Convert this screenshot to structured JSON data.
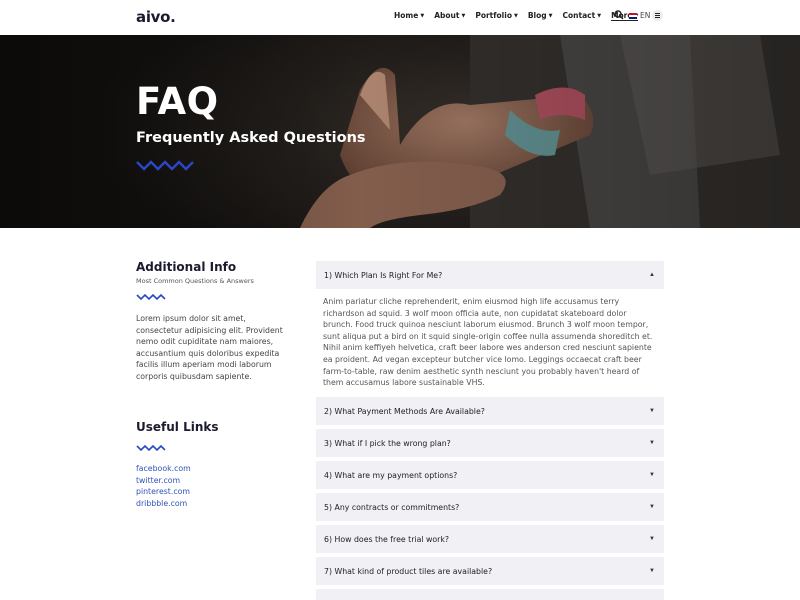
{
  "header": {
    "logo": "aivo.",
    "nav": [
      {
        "label": "Home",
        "active": false
      },
      {
        "label": "About",
        "active": false
      },
      {
        "label": "Portfolio",
        "active": false
      },
      {
        "label": "Blog",
        "active": false
      },
      {
        "label": "Contact",
        "active": false
      },
      {
        "label": "More",
        "active": true
      }
    ],
    "lang": "EN",
    "search_icon": "search-icon",
    "menu_icon": "hamburger-icon"
  },
  "hero": {
    "title": "FAQ",
    "subtitle": "Frequently Asked Questions"
  },
  "sidebar": {
    "info_title": "Additional Info",
    "info_sub": "Most Common Questions & Answers",
    "info_text": "Lorem ipsum dolor sit amet, consectetur adipisicing elit. Provident nemo odit cupiditate nam maiores, accusantium quis doloribus expedita facilis illum aperiam modi laborum corporis quibusdam sapiente.",
    "links_title": "Useful Links",
    "links": [
      "facebook.com",
      "twitter.com",
      "pinterest.com",
      "dribbble.com"
    ]
  },
  "faq": {
    "items": [
      {
        "question": "1) Which Plan Is Right For Me?",
        "open": true,
        "answer": "Anim pariatur cliche reprehenderit, enim eiusmod high life accusamus terry richardson ad squid. 3 wolf moon officia aute, non cupidatat skateboard dolor brunch. Food truck quinoa nesciunt laborum eiusmod. Brunch 3 wolf moon tempor, sunt aliqua put a bird on it squid single-origin coffee nulla assumenda shoreditch et. Nihil anim keffiyeh helvetica, craft beer labore wes anderson cred nesciunt sapiente ea proident. Ad vegan excepteur butcher vice lomo. Leggings occaecat craft beer farm-to-table, raw denim aesthetic synth nesciunt you probably haven't heard of them accusamus labore sustainable VHS."
      },
      {
        "question": "2) What Payment Methods Are Available?",
        "open": false
      },
      {
        "question": "3) What if I pick the wrong plan?",
        "open": false
      },
      {
        "question": "4) What are my payment options?",
        "open": false
      },
      {
        "question": "5) Any contracts or commitments?",
        "open": false
      },
      {
        "question": "6) How does the free trial work?",
        "open": false
      },
      {
        "question": "7) What kind of product tiles are available?",
        "open": false
      }
    ]
  },
  "colors": {
    "accent": "#2a47c8",
    "link": "#2f53b8",
    "accordion_bg": "#f0f0f5"
  }
}
